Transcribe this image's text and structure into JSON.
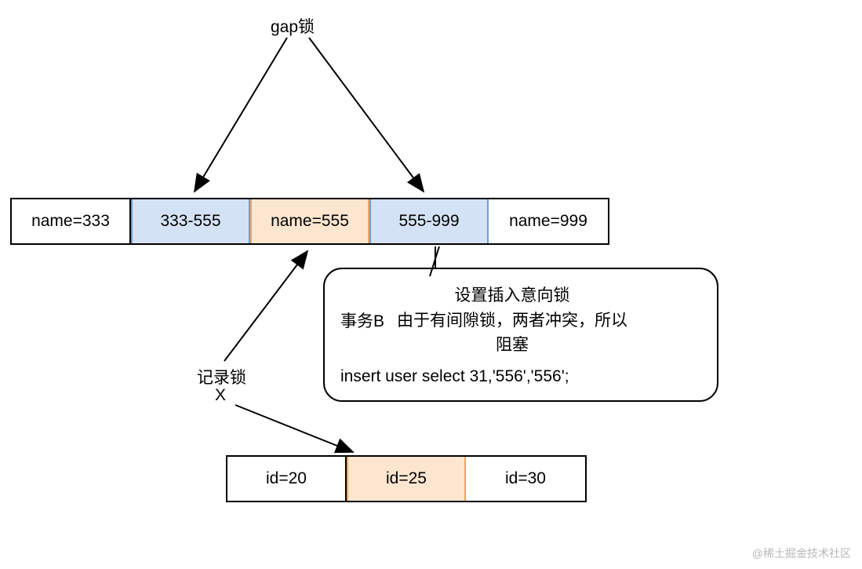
{
  "labels": {
    "gap_lock": "gap锁",
    "record_lock": "记录锁",
    "record_lock_x": "X",
    "tx_b": "事务B"
  },
  "top_row": [
    "name=333",
    "333-555",
    "name=555",
    "555-999",
    "name=999"
  ],
  "bottom_row": [
    "id=20",
    "id=25",
    "id=30"
  ],
  "callout": {
    "line1": "设置插入意向锁",
    "line2": "由于有间隙锁，两者冲突，所以",
    "line3": "阻塞",
    "sql": "insert user select 31,'556','556';"
  },
  "watermark": "@稀土掘金技术社区"
}
